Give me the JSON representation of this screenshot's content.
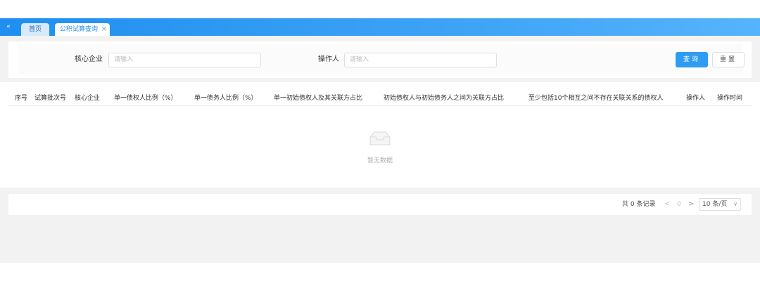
{
  "tabs": {
    "collapse_icon": "«",
    "home": "首页",
    "active": "公积试算查询",
    "close_icon": "×"
  },
  "search": {
    "enterprise_label": "核心企业",
    "enterprise_placeholder": "请输入",
    "operator_label": "操作人",
    "operator_placeholder": "请输入",
    "query_button": "查询",
    "reset_button": "重置"
  },
  "table": {
    "columns": [
      "序号",
      "试算批次号",
      "核心企业",
      "单一债权人比例（%）",
      "单一债务人比例（%）",
      "单一初始债权人及其关联方占比",
      "初始债权人与初始债务人之间为关联方占比",
      "至少包括10个相互之间不存在关联关系的债权人",
      "操作人",
      "操作时间"
    ],
    "empty_text": "暂无数据"
  },
  "pagination": {
    "total": "共 0 条记录",
    "prev": "<",
    "current": "0",
    "next": ">",
    "page_size": "10 条/页",
    "caret": "∨"
  },
  "colors": {
    "topbar": "#2b90ee",
    "primary": "#2e9cf3"
  }
}
